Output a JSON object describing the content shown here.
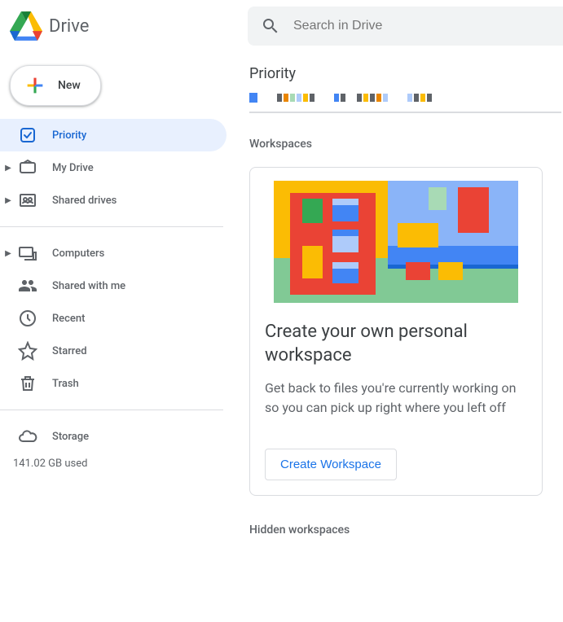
{
  "header": {
    "app_name": "Drive",
    "search_placeholder": "Search in Drive"
  },
  "sidebar": {
    "new_label": "New",
    "items": [
      {
        "key": "priority",
        "label": "Priority",
        "expandable": false,
        "active": true
      },
      {
        "key": "mydrive",
        "label": "My Drive",
        "expandable": true,
        "active": false
      },
      {
        "key": "shareddrives",
        "label": "Shared drives",
        "expandable": true,
        "active": false
      }
    ],
    "section2": [
      {
        "key": "computers",
        "label": "Computers",
        "expandable": true
      },
      {
        "key": "sharedwithme",
        "label": "Shared with me",
        "expandable": false
      },
      {
        "key": "recent",
        "label": "Recent",
        "expandable": false
      },
      {
        "key": "starred",
        "label": "Starred",
        "expandable": false
      },
      {
        "key": "trash",
        "label": "Trash",
        "expandable": false
      }
    ],
    "storage_label": "Storage",
    "storage_used": "141.02 GB used"
  },
  "main": {
    "title": "Priority",
    "workspaces_label": "Workspaces",
    "workspace_card": {
      "title": "Create your own personal workspace",
      "description": "Get back to files you're currently working on so you can pick up right where you left off",
      "button_label": "Create Workspace"
    },
    "hidden_label": "Hidden workspaces"
  }
}
